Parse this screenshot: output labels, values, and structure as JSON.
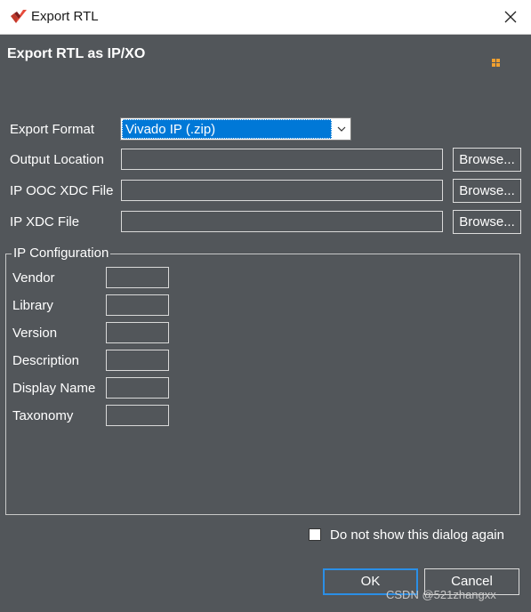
{
  "window": {
    "title": "Export RTL"
  },
  "header": {
    "title": "Export RTL as IP/XO"
  },
  "form": {
    "export_format_label": "Export Format",
    "export_format_value": "Vivado IP (.zip)",
    "output_location_label": "Output Location",
    "output_location_value": "",
    "ip_ooc_xdc_label": "IP OOC XDC File",
    "ip_ooc_xdc_value": "",
    "ip_xdc_label": "IP XDC File",
    "ip_xdc_value": "",
    "browse_label": "Browse..."
  },
  "ip_config": {
    "title": "IP Configuration",
    "fields": [
      {
        "label": "Vendor",
        "value": ""
      },
      {
        "label": "Library",
        "value": ""
      },
      {
        "label": "Version",
        "value": ""
      },
      {
        "label": "Description",
        "value": ""
      },
      {
        "label": "Display Name",
        "value": ""
      },
      {
        "label": "Taxonomy",
        "value": ""
      }
    ]
  },
  "footer": {
    "dont_show_label": "Do not show this dialog again",
    "dont_show_checked": false,
    "ok_label": "OK",
    "cancel_label": "Cancel"
  },
  "watermark": "CSDN @521zhangxx",
  "colors": {
    "background": "#52565a",
    "selection": "#0078d7",
    "default_button_border": "#2b8fe6"
  }
}
